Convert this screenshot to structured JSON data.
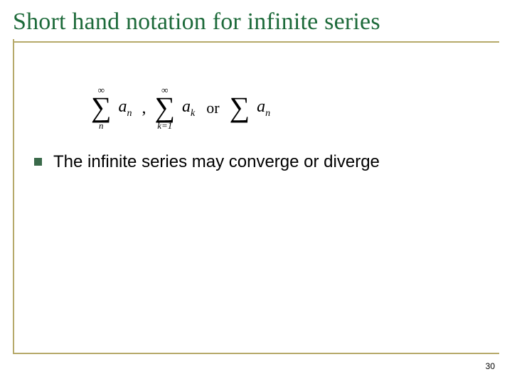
{
  "title": "Short hand notation for infinite series",
  "formula": {
    "sum1": {
      "upper": "∞",
      "sigma": "∑",
      "lower": "n",
      "term_base": "a",
      "term_sub": "n"
    },
    "sep1": ",",
    "sum2": {
      "upper": "∞",
      "sigma": "∑",
      "lower": "k=1",
      "term_base": "a",
      "term_sub": "k"
    },
    "or_text": "or",
    "sum3": {
      "upper": "",
      "sigma": "∑",
      "lower": "",
      "term_base": "a",
      "term_sub": "n"
    }
  },
  "bullet_text": "The infinite series may converge or diverge",
  "page_number": "30"
}
